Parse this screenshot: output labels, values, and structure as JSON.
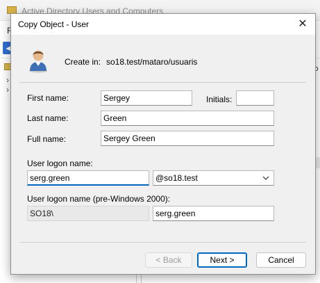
{
  "background_window": {
    "title": "Active Directory Users and Computers",
    "menu_first": "F",
    "right_fragment": "io"
  },
  "dialog": {
    "title": "Copy Object - User",
    "close_glyph": "✕",
    "create_in_label": "Create in:",
    "create_in_path": "so18.test/mataro/usuaris",
    "first_name_label": "First name:",
    "first_name_value": "Sergey",
    "initials_label": "Initials:",
    "initials_value": "",
    "last_name_label": "Last name:",
    "last_name_value": "Green",
    "full_name_label": "Full name:",
    "full_name_value": "Sergey Green",
    "logon_label": "User logon name:",
    "logon_value": "serg.green",
    "domain_value": "@so18.test",
    "pre2000_label": "User logon name (pre-Windows 2000):",
    "pre2000_domain": "SO18\\",
    "pre2000_value": "serg.green",
    "back_button": "< Back",
    "next_button": "Next >",
    "cancel_button": "Cancel"
  },
  "icons": [
    "user-icon",
    "close-icon",
    "chevron-down-icon",
    "back-arrow-icon",
    "folder-icon"
  ],
  "colors": {
    "accent": "#0067c0",
    "dialog_bg": "#f0f0f0",
    "disabled_text": "#9a9a9a"
  }
}
